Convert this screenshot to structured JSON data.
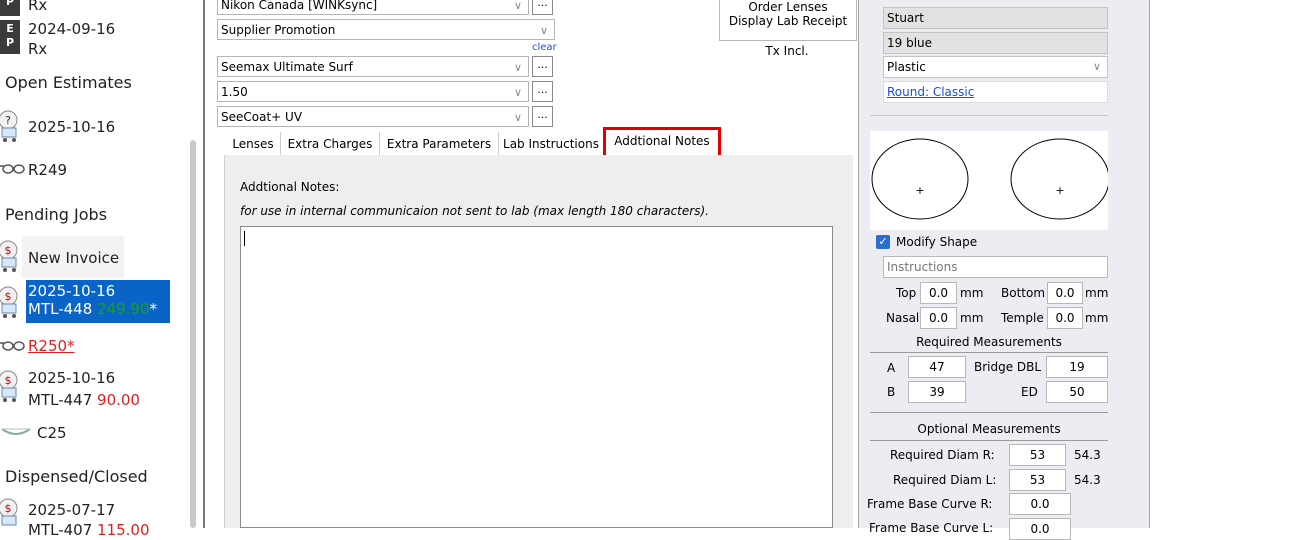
{
  "sidebar": {
    "entries_top": [
      {
        "badge": "E\nP",
        "label": "Rx"
      },
      {
        "badge": "E\nP",
        "date": "2024-09-16",
        "label": "Rx"
      }
    ],
    "open_estimates": {
      "title": "Open Estimates",
      "items": [
        {
          "date": "2025-10-16"
        },
        {
          "frame": "R249"
        }
      ]
    },
    "pending_jobs": {
      "title": "Pending Jobs",
      "items": [
        {
          "label": "New Invoice"
        },
        {
          "date": "2025-10-16",
          "job": "MTL-448",
          "amount": "249.90",
          "suffix": "*"
        },
        {
          "frame": "R250*"
        },
        {
          "date": "2025-10-16",
          "job": "MTL-447",
          "amount": "90.00"
        },
        {
          "frame": "C25"
        }
      ]
    },
    "dispensed": {
      "title": "Dispensed/Closed",
      "items": [
        {
          "date": "2025-07-17",
          "job": "MTL-407",
          "amount": "115.00"
        }
      ]
    }
  },
  "order": {
    "supplier": "Nikon Canada [WINKsync]",
    "promotion": "Supplier Promotion",
    "clear_label": "clear",
    "lens": "Seemax Ultimate Surf",
    "index": "1.50",
    "coating": "SeeCoat+ UV",
    "dots_label": "...",
    "order_lenses": "Order Lenses",
    "display_receipt": "Display Lab Receipt",
    "tx_incl": "Tx Incl."
  },
  "tabs": [
    {
      "label": "Lenses"
    },
    {
      "label": "Extra Charges"
    },
    {
      "label": "Extra Parameters"
    },
    {
      "label": "Lab Instructions"
    },
    {
      "label": "Addtional Notes",
      "active": true
    }
  ],
  "notes": {
    "title": "Addtional Notes:",
    "hint": "for use in internal communicaion not sent to lab (max length 180 characters).",
    "value": ""
  },
  "frame": {
    "brand": "Stuart",
    "color": "19 blue",
    "material": "Plastic",
    "shape_link": "Round: Classic",
    "modify_shape_label": "Modify Shape",
    "modify_shape_checked": true,
    "instructions_placeholder": "Instructions",
    "top_label": "Top",
    "top": "0.0",
    "bottom_label": "Bottom",
    "bottom": "0.0",
    "nasal_label": "Nasal",
    "nasal": "0.0",
    "temple_label": "Temple",
    "temple": "0.0",
    "mm": "mm",
    "required_title": "Required Measurements",
    "a_label": "A",
    "a": "47",
    "bridge_label": "Bridge DBL",
    "bridge": "19",
    "b_label": "B",
    "b": "39",
    "ed_label": "ED",
    "ed": "50",
    "optional_title": "Optional Measurements",
    "diam_r_label": "Required Diam R:",
    "diam_r": "53",
    "diam_r_calc": "54.3",
    "diam_l_label": "Required Diam L:",
    "diam_l": "53",
    "diam_l_calc": "54.3",
    "base_r_label": "Frame Base Curve R:",
    "base_r": "0.0",
    "base_l_label": "Frame Base Curve L:",
    "base_l": "0.0"
  },
  "colors": {
    "accent": "#0a64c8",
    "highlight": "#e00000",
    "amount_green": "#19a019",
    "amount_red": "#e02020"
  }
}
